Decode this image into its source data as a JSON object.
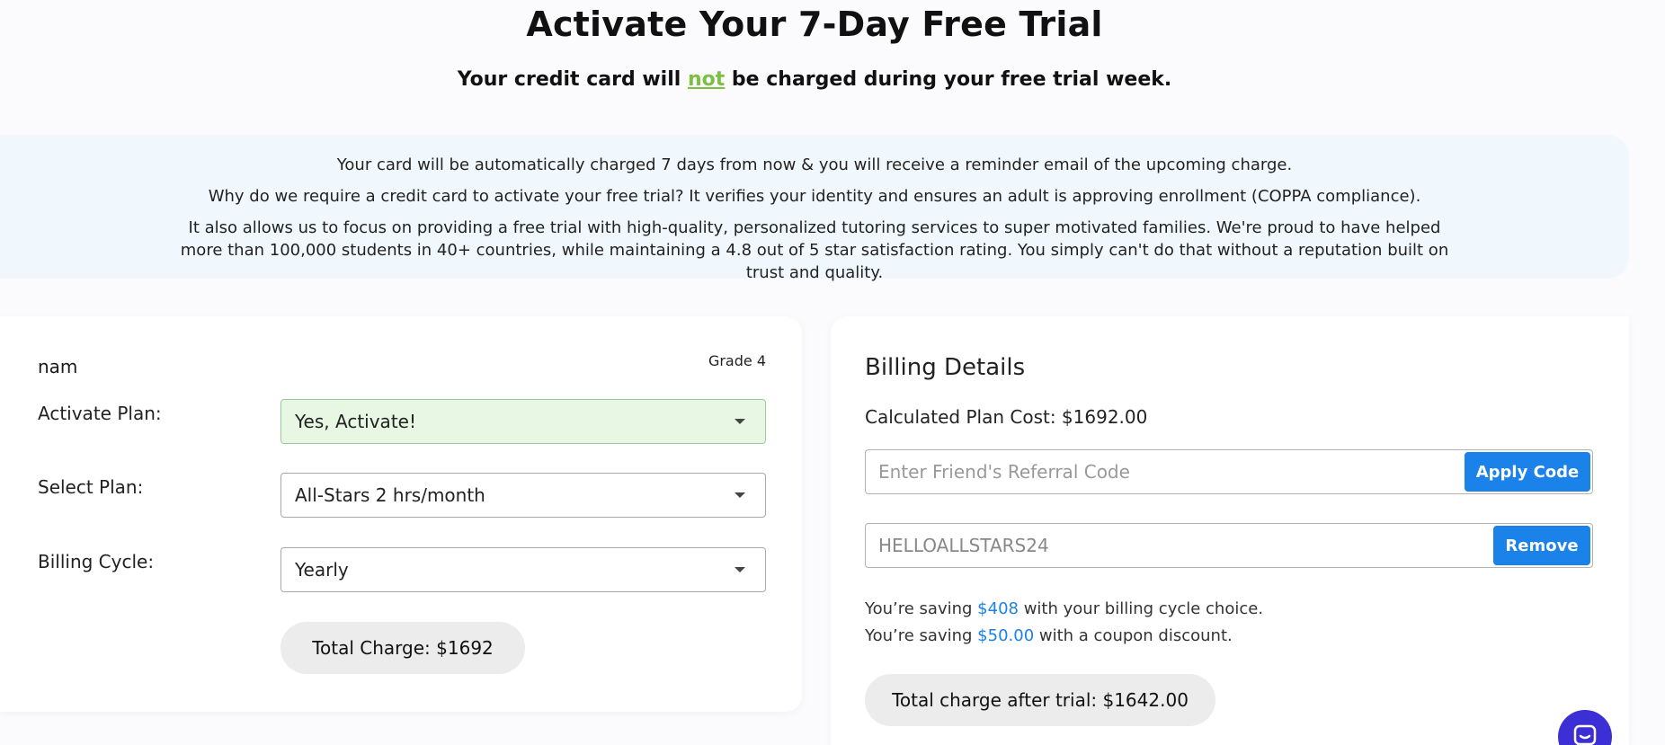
{
  "header": {
    "title": "Activate Your 7-Day Free Trial",
    "subtitle_before": "Your credit card will ",
    "subtitle_emphasis": "not",
    "subtitle_after": " be charged during your free trial week."
  },
  "info": {
    "line1": "Your card will be automatically charged 7 days from now & you will receive a reminder email of the upcoming charge.",
    "line2": "Why do we require a credit card to activate your free trial? It verifies your identity and ensures an adult is approving enrollment (COPPA compliance).",
    "line3": "It also allows us to focus on providing a free trial with high-quality, personalized tutoring services to super motivated families. We're proud to have helped more than 100,000 students in 40+ countries, while maintaining a 4.8 out of 5 star satisfaction rating. You simply can't do that without a reputation built on trust and quality."
  },
  "student": {
    "name": "nam",
    "grade": "Grade 4",
    "activate_label": "Activate Plan:",
    "activate_value": "Yes, Activate!",
    "plan_label": "Select Plan:",
    "plan_value": "All-Stars 2 hrs/month",
    "cycle_label": "Billing Cycle:",
    "cycle_value": "Yearly",
    "total": "Total Charge: $1692"
  },
  "billing": {
    "title": "Billing Details",
    "plan_cost": "Calculated Plan Cost: $1692.00",
    "referral_placeholder": "Enter Friend's Referral Code",
    "apply_label": "Apply Code",
    "coupon_value": "HELLOALLSTARS24",
    "remove_label": "Remove",
    "saving1_before": "You’re saving ",
    "saving1_amount": "$408",
    "saving1_after": " with your billing cycle choice.",
    "saving2_before": "You’re saving ",
    "saving2_amount": "$50.00",
    "saving2_after": " with a coupon discount.",
    "after_trial": "Total charge after trial: $1642.00"
  },
  "colors": {
    "accent_blue": "#1a82e8",
    "emphasis_green": "#7cc043",
    "active_select_bg": "#e8f7e4",
    "chat_purple": "#3c2fd6"
  },
  "icons": {
    "dropdown": "caret-down-icon",
    "chat": "chat-icon"
  }
}
